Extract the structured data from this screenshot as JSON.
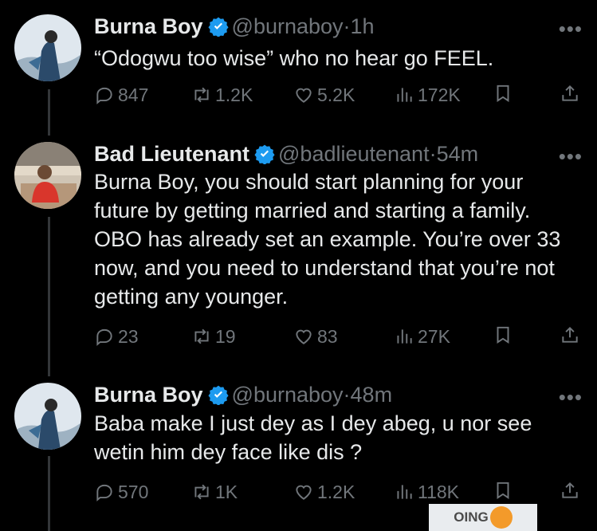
{
  "tweets": [
    {
      "name": "Burna Boy",
      "handle": "@burnaboy",
      "separator": "·",
      "time": "1h",
      "text": "“Odogwu too wise”  who no hear go FEEL.",
      "replies": "847",
      "reposts": "1.2K",
      "likes": "5.2K",
      "views": "172K"
    },
    {
      "name": "Bad Lieutenant",
      "handle": "@badlieutenant",
      "separator": "·",
      "time": "54m",
      "text": "Burna Boy, you should start planning for your future by getting married and starting a family. OBO has already set an example. You’re over 33 now, and you need to understand that you’re not getting any younger.",
      "replies": "23",
      "reposts": "19",
      "likes": "83",
      "views": "27K"
    },
    {
      "name": "Burna Boy",
      "handle": "@burnaboy",
      "separator": "·",
      "time": "48m",
      "text": "Baba make I just dey as I dey abeg, u nor see wetin him dey face like dis ?",
      "replies": "570",
      "reposts": "1K",
      "likes": "1.2K",
      "views": "118K"
    }
  ],
  "more_label": "•••",
  "watermark": {
    "text_before": "OING"
  },
  "colors": {
    "background": "#000000",
    "text": "#e7e9ea",
    "muted": "#71767b",
    "verified": "#1d9bf0"
  }
}
